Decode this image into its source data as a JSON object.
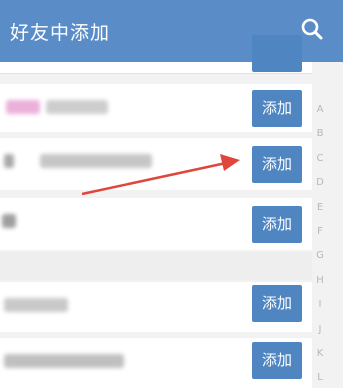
{
  "header": {
    "title": "好友中添加",
    "search_icon": "search-icon"
  },
  "rows": [
    {
      "button": ""
    },
    {
      "button": "添加"
    },
    {
      "button": "添加"
    },
    {
      "button": "添加"
    },
    {
      "button": "添加"
    },
    {
      "button": "添加"
    }
  ],
  "index_letters": [
    "A",
    "B",
    "C",
    "D",
    "E",
    "F",
    "G",
    "H",
    "I",
    "J",
    "K",
    "L"
  ],
  "colors": {
    "header_bg": "#5a8dc8",
    "button_bg": "#4f86c2",
    "arrow": "#e0473c"
  }
}
